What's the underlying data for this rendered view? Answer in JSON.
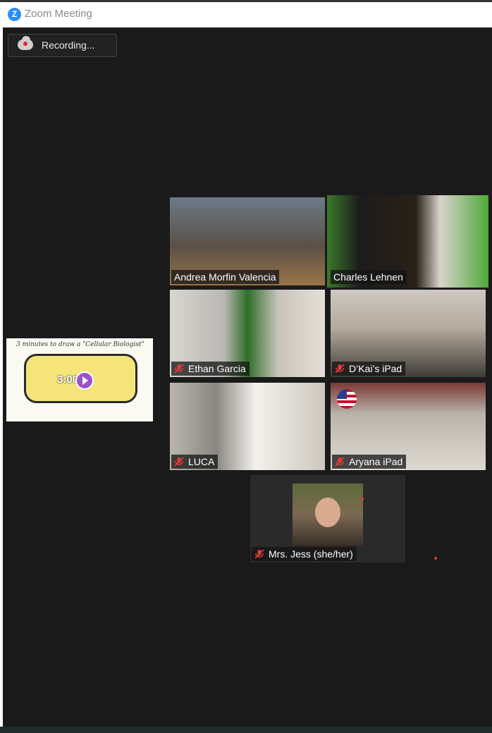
{
  "window": {
    "title": "Zoom Meeting",
    "logo_letter": "Z"
  },
  "recording": {
    "label": "Recording..."
  },
  "share": {
    "slide_title": "3 minutes to draw a \"Cellular Biologist\"",
    "timer": "3:00"
  },
  "participants": [
    {
      "name": "Andrea Morfin Valencia",
      "muted": false,
      "active": false
    },
    {
      "name": "Charles Lehnen",
      "muted": false,
      "active": true
    },
    {
      "name": "Ethan Garcia",
      "muted": true,
      "active": false
    },
    {
      "name": "D’Kai’s iPad",
      "muted": true,
      "active": false
    },
    {
      "name": "LUCA",
      "muted": true,
      "active": false
    },
    {
      "name": "Aryana iPad",
      "muted": true,
      "active": false
    },
    {
      "name": "Mrs. Jess (she/her)",
      "muted": true,
      "active": false
    }
  ],
  "colors": {
    "active_speaker": "#c9f25a",
    "background": "#1a1a1a",
    "mute_icon": "#e53a3a"
  }
}
